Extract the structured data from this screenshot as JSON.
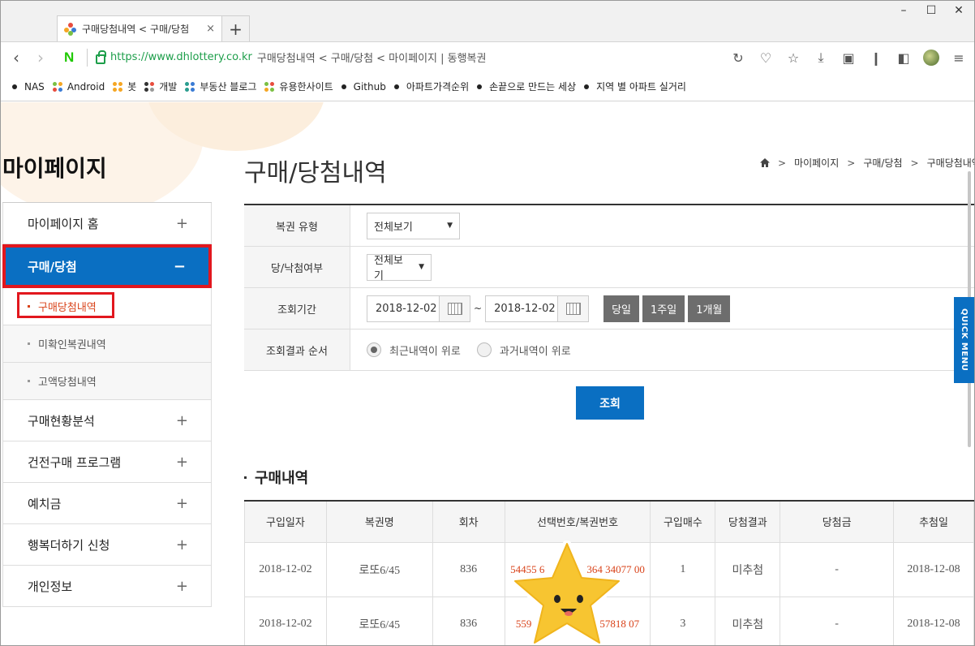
{
  "browser": {
    "tab_title": "구매당첨내역 < 구매/당첨",
    "tab_close": "×",
    "new_tab": "+",
    "url": "https://www.dhlottery.co.kr",
    "url_title": "구매당첨내역 < 구매/당첨 < 마이페이지 | 동행복권",
    "naver_logo": "N",
    "window_controls": [
      "–",
      "☐",
      "✕"
    ]
  },
  "bookmarks": [
    {
      "label": "NAS",
      "icon": "dot-icon"
    },
    {
      "label": "Android",
      "icon": "folder-grid-icon"
    },
    {
      "label": "봇",
      "icon": "folder-grid-icon"
    },
    {
      "label": "개발",
      "icon": "folder-grid-icon"
    },
    {
      "label": "부동산 블로그",
      "icon": "folder-grid-icon"
    },
    {
      "label": "유용한사이트",
      "icon": "folder-grid-icon"
    },
    {
      "label": "Github",
      "icon": "dot-icon"
    },
    {
      "label": "아파트가격순위",
      "icon": "dot-icon"
    },
    {
      "label": "손끝으로 만드는 세상",
      "icon": "dot-icon"
    },
    {
      "label": "지역 별 아파트 실거리",
      "icon": "dot-icon"
    }
  ],
  "sidebar": {
    "title": "마이페이지",
    "items": [
      {
        "label": "마이페이지 홈",
        "toggle": "+"
      },
      {
        "label": "구매/당첨",
        "toggle": "−"
      },
      {
        "label": "구매현황분석",
        "toggle": "+"
      },
      {
        "label": "건전구매 프로그램",
        "toggle": "+"
      },
      {
        "label": "예치금",
        "toggle": "+"
      },
      {
        "label": "행복더하기 신청",
        "toggle": "+"
      },
      {
        "label": "개인정보",
        "toggle": "+"
      }
    ],
    "subitems": [
      "구매당첨내역",
      "미확인복권내역",
      "고액당첨내역"
    ]
  },
  "main": {
    "title": "구매/당첨내역",
    "breadcrumb": [
      "마이페이지",
      "구매/당첨",
      "구매당첨내역"
    ],
    "breadcrumb_sep": ">",
    "filters": {
      "type_label": "복권 유형",
      "type_value": "전체보기",
      "win_label": "당/낙첨여부",
      "win_value": "전체보기",
      "period_label": "조회기간",
      "date_from": "2018-12-02",
      "date_to": "2018-12-02",
      "date_sep": "~",
      "period_buttons": [
        "당일",
        "1주일",
        "1개월"
      ],
      "order_label": "조회결과 순서",
      "order_options": [
        "최근내역이 위로",
        "과거내역이 위로"
      ],
      "search_button": "조회"
    },
    "list_title": "구매내역",
    "columns": [
      "구입일자",
      "복권명",
      "회차",
      "선택번호/복권번호",
      "구입매수",
      "당첨결과",
      "당첨금",
      "추첨일"
    ],
    "rows": [
      [
        "2018-12-02",
        "로또6/45",
        "836",
        "54455 6",
        "364 34077 00",
        "1",
        "미추첨",
        "-",
        "2018-12-08"
      ],
      [
        "2018-12-02",
        "로또6/45",
        "836",
        "559",
        "57818 07",
        "3",
        "미추첨",
        "-",
        "2018-12-08"
      ]
    ]
  },
  "quick_menu": "QUICK MENU",
  "colors": {
    "accent": "#0a6fc2",
    "highlight": "#e2171e",
    "link": "#d9431a"
  }
}
